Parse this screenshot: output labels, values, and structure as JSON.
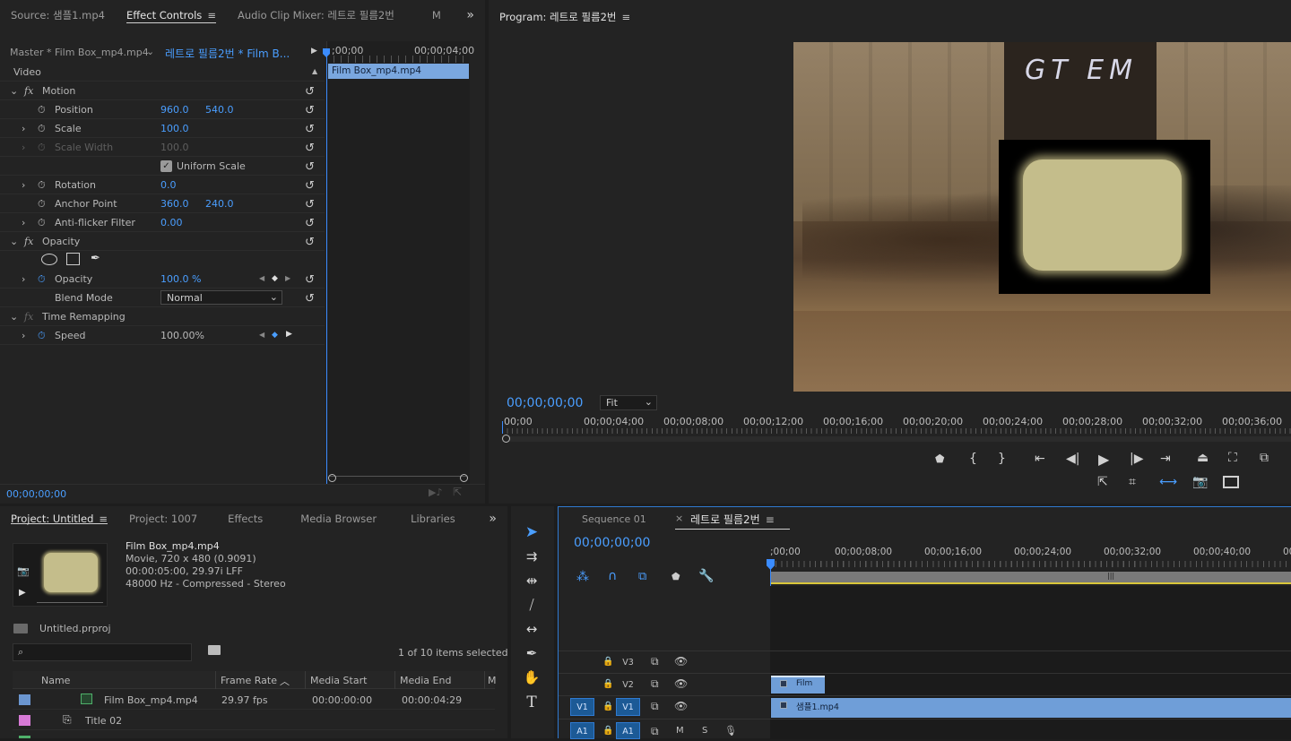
{
  "source_panel": {
    "tabs": [
      "Source: 샘플1.mp4",
      "Effect Controls",
      "Audio Clip Mixer: 레트로 필름2번",
      "M"
    ],
    "active": "Effect Controls",
    "master_label": "Master * Film Box_mp4.mp4",
    "clip_label": "레트로 필름2번 * Film B...",
    "ruler_start": ";00;00",
    "ruler_end": "00;00;04;00",
    "clip_bar": "Film Box_mp4.mp4",
    "section_video": "Video",
    "motion": "Motion",
    "position_label": "Position",
    "position_x": "960.0",
    "position_y": "540.0",
    "scale_label": "Scale",
    "scale_val": "100.0",
    "scale_width_label": "Scale Width",
    "scale_width_val": "100.0",
    "uniform_scale": "Uniform Scale",
    "rotation_label": "Rotation",
    "rotation_val": "0.0",
    "anchor_label": "Anchor Point",
    "anchor_x": "360.0",
    "anchor_y": "240.0",
    "anti_label": "Anti-flicker Filter",
    "anti_val": "0.00",
    "opacity_section": "Opacity",
    "opacity_label": "Opacity",
    "opacity_val": "100.0 %",
    "blend_label": "Blend Mode",
    "blend_val": "Normal",
    "time_remap": "Time Remapping",
    "speed_label": "Speed",
    "speed_val": "100.00%",
    "timecode": "00;00;00;00"
  },
  "program": {
    "title": "Program: 레트로 필름2번",
    "timecode": "00;00;00;00",
    "fit": "Fit",
    "ruler": [
      "00;00",
      "00;00;04;00",
      "00;00;08;00",
      "00;00;12;00",
      "00;00;16;00",
      "00;00;20;00",
      "00;00;24;00",
      "00;00;28;00",
      "00;00;32;00",
      "00;00;36;00",
      "00;0"
    ]
  },
  "project": {
    "tabs": [
      "Project: Untitled",
      "Project: 1007",
      "Effects",
      "Media Browser",
      "Libraries"
    ],
    "active": "Project: Untitled",
    "clip_name": "Film Box_mp4.mp4",
    "clip_info1": "Movie, 720 x 480 (0.9091)",
    "clip_info2": "00:00:05:00, 29.97i LFF",
    "clip_info3": "48000 Hz - Compressed - Stereo",
    "proj_file": "Untitled.prproj",
    "items_selected": "1 of 10 items selected",
    "columns": [
      "Name",
      "Frame Rate",
      "Media Start",
      "Media End",
      "M"
    ],
    "rows": [
      {
        "color": "#6b96d0",
        "name": "Film Box_mp4.mp4",
        "fps": "29.97 fps",
        "start": "00:00:00:00",
        "end": "00:00:04:29"
      },
      {
        "color": "#d77ad6",
        "name": "Title 02",
        "fps": "",
        "start": "",
        "end": ""
      }
    ]
  },
  "timeline": {
    "tabs": [
      "Sequence 01",
      "레트로 필름2번"
    ],
    "active": "레트로 필름2번",
    "timecode": "00;00;00;00",
    "ruler": [
      ";00;00",
      "00;00;08;00",
      "00;00;16;00",
      "00;00;24;00",
      "00;00;32;00",
      "00;00;40;00",
      "00;0"
    ],
    "tracks": [
      "V3",
      "V2",
      "V1",
      "A1"
    ],
    "clip_v2": "Film",
    "clip_v1": "샘플1.mp4"
  },
  "colors": {
    "accent": "#4a9eff",
    "clip_blue": "#6f9ed8",
    "clip_bar": "#7aa7df"
  }
}
